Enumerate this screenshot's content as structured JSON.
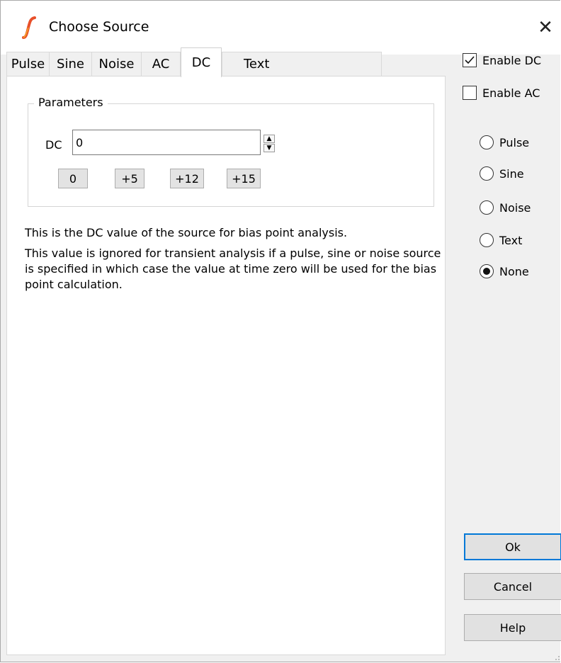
{
  "window": {
    "title": "Choose Source",
    "close_glyph": "✕"
  },
  "tabs": [
    {
      "label": "Pulse",
      "active": false
    },
    {
      "label": "Sine",
      "active": false
    },
    {
      "label": "Noise",
      "active": false
    },
    {
      "label": "AC",
      "active": false
    },
    {
      "label": "DC",
      "active": true
    },
    {
      "label": "Text",
      "active": false
    }
  ],
  "parameters": {
    "group_label": "Parameters",
    "dc_label": "DC",
    "dc_value": "0",
    "presets": [
      "0",
      "+5",
      "+12",
      "+15"
    ]
  },
  "description": {
    "line1": "This is the DC value of the source for bias point analysis.",
    "line2": "This value is ignored for transient analysis if a pulse, sine or noise source is specified in which case the value at time zero will be used for the bias point calculation."
  },
  "checkboxes": [
    {
      "label": "Enable DC",
      "checked": true
    },
    {
      "label": "Enable AC",
      "checked": false
    }
  ],
  "radios": [
    {
      "label": "Pulse",
      "selected": false
    },
    {
      "label": "Sine",
      "selected": false
    },
    {
      "label": "Noise",
      "selected": false
    },
    {
      "label": "Text",
      "selected": false
    },
    {
      "label": "None",
      "selected": true
    }
  ],
  "buttons": {
    "ok": "Ok",
    "cancel": "Cancel",
    "help": "Help"
  },
  "colors": {
    "accent": "#0078d7",
    "app_icon": "#e8502a"
  }
}
